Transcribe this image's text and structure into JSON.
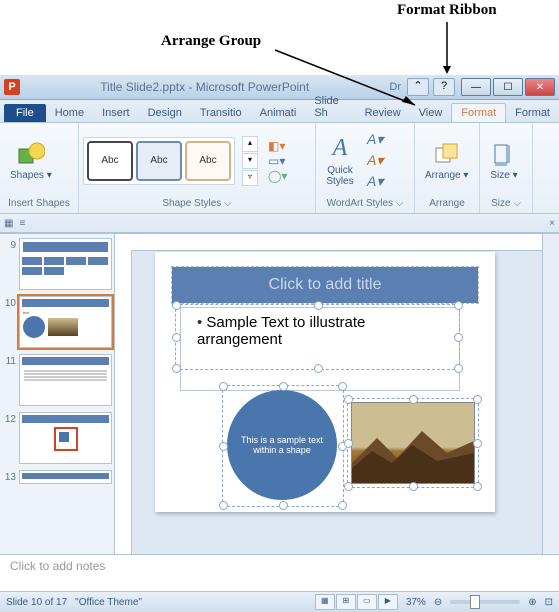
{
  "annotations": {
    "arrange": "Arrange Group",
    "format": "Format Ribbon"
  },
  "title": "Title Slide2.pptx  -  Microsoft PowerPoint",
  "title_suffix": "Dr",
  "tabs": {
    "file": "File",
    "home": "Home",
    "insert": "Insert",
    "design": "Design",
    "transitions": "Transitio",
    "animations": "Animati",
    "slideshow": "Slide Sh",
    "review": "Review",
    "view": "View",
    "format1": "Format",
    "format2": "Format"
  },
  "ribbon": {
    "insert_shapes": "Insert Shapes",
    "shapes": "Shapes",
    "shape_styles": "Shape Styles",
    "abc": "Abc",
    "wordart": "WordArt Styles",
    "quick_styles": "Quick\nStyles",
    "arrange_group": "Arrange",
    "arrange": "Arrange",
    "size_group": "Size",
    "size": "Size"
  },
  "slide": {
    "title_placeholder": "Click to add title",
    "bullet": "Sample Text to illustrate arrangement",
    "circle_text": "This is a sample text within a shape"
  },
  "thumbs": [
    "9",
    "10",
    "11",
    "12",
    "13"
  ],
  "notes_placeholder": "Click to add notes",
  "status": {
    "slide": "Slide 10 of 17",
    "theme": "\"Office Theme\"",
    "zoom": "37%"
  }
}
